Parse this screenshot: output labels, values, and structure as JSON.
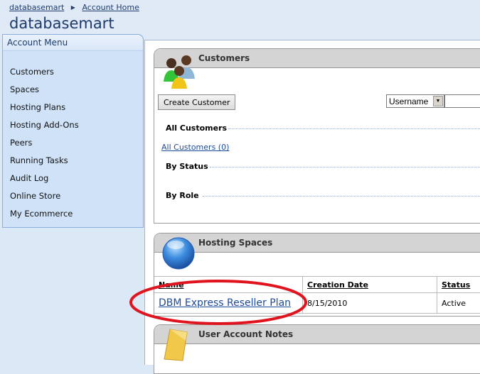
{
  "breadcrumb": {
    "root": "databasemart",
    "current": "Account Home"
  },
  "site_title": "databasemart",
  "sidebar": {
    "title": "Account Menu",
    "items": [
      {
        "label": "Customers"
      },
      {
        "label": "Spaces"
      },
      {
        "label": "Hosting Plans"
      },
      {
        "label": "Hosting Add-Ons"
      },
      {
        "label": "Peers"
      },
      {
        "label": "Running Tasks"
      },
      {
        "label": "Audit Log"
      },
      {
        "label": "Online Store"
      },
      {
        "label": "My Ecommerce"
      }
    ]
  },
  "customers": {
    "title": "Customers",
    "create_button": "Create Customer",
    "search_field_selected": "Username",
    "search_value": "",
    "sections": {
      "all": "All Customers",
      "all_link": "All Customers (0)",
      "by_status": "By Status",
      "by_role": "By Role"
    }
  },
  "hosting_spaces": {
    "title": "Hosting Spaces",
    "columns": [
      "Name",
      "Creation Date",
      "Status"
    ],
    "rows": [
      {
        "name": "DBM Express Reseller Plan",
        "created": "8/15/2010",
        "status": "Active"
      }
    ]
  },
  "notes": {
    "title": "User Account Notes"
  },
  "annotation": {
    "color": "#e0141e",
    "shape": "ellipse"
  }
}
